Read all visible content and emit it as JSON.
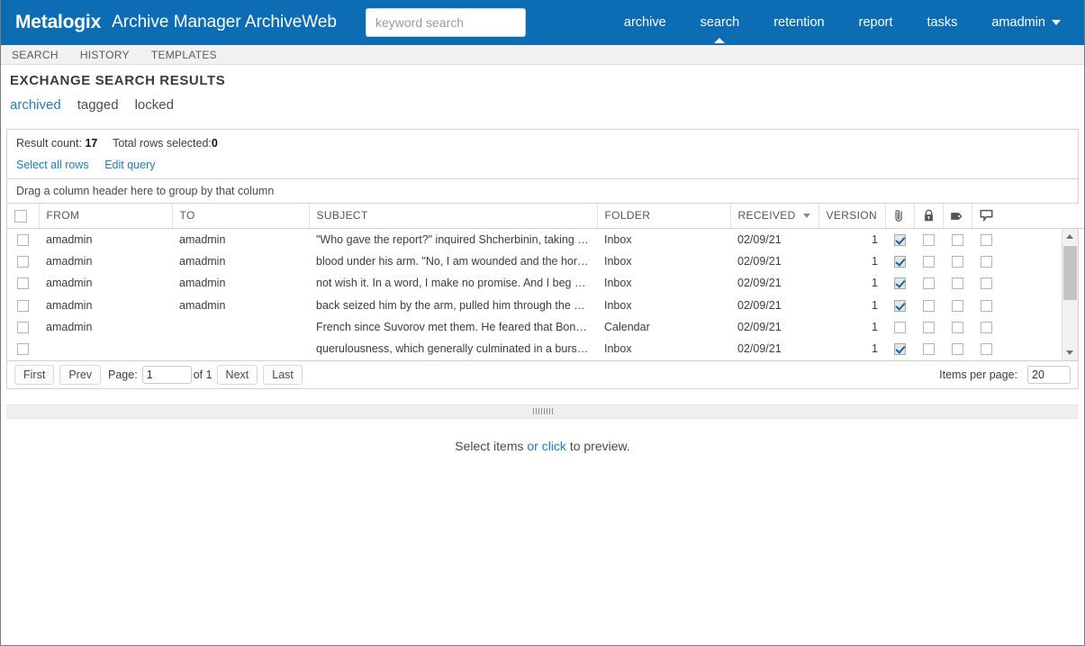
{
  "header": {
    "brand": "Metalogix",
    "app_name": "Archive Manager ArchiveWeb",
    "brand_color": "#0c6db5",
    "accent_color": "#1a7ec2",
    "search": {
      "placeholder": "keyword search",
      "value": "",
      "icon": "search-icon"
    },
    "nav": [
      {
        "label": "archive",
        "active": false
      },
      {
        "label": "search",
        "active": true
      },
      {
        "label": "retention",
        "active": false
      },
      {
        "label": "report",
        "active": false
      },
      {
        "label": "tasks",
        "active": false
      }
    ],
    "user_menu": {
      "label": "amadmin",
      "icon": "chevron-down-icon"
    }
  },
  "subtabs": [
    {
      "label": "SEARCH"
    },
    {
      "label": "HISTORY"
    },
    {
      "label": "TEMPLATES"
    }
  ],
  "page": {
    "title": "EXCHANGE SEARCH RESULTS",
    "filters": [
      {
        "label": "archived",
        "active": true
      },
      {
        "label": "tagged",
        "active": false
      },
      {
        "label": "locked",
        "active": false
      }
    ]
  },
  "results": {
    "result_count_label": "Result count:",
    "result_count_value": "17",
    "total_rows_label": "Total rows selected:",
    "total_rows_value": "0",
    "select_all_link": "Select all rows",
    "edit_query_link": "Edit query",
    "group_hint": "Drag a column header here to group by that column"
  },
  "grid": {
    "columns": [
      {
        "key": "select",
        "label": "",
        "type": "checkbox",
        "icon": "checkbox-icon"
      },
      {
        "key": "from",
        "label": "FROM",
        "type": "text"
      },
      {
        "key": "to",
        "label": "TO",
        "type": "text"
      },
      {
        "key": "subject",
        "label": "SUBJECT",
        "type": "text"
      },
      {
        "key": "folder",
        "label": "FOLDER",
        "type": "text"
      },
      {
        "key": "received",
        "label": "RECEIVED",
        "type": "text",
        "sorted": "desc",
        "icon": "sort-desc-icon"
      },
      {
        "key": "version",
        "label": "VERSION",
        "type": "number"
      },
      {
        "key": "attachment",
        "label": "",
        "type": "checkbox",
        "icon": "paperclip-icon"
      },
      {
        "key": "locked",
        "label": "",
        "type": "checkbox",
        "icon": "lock-icon"
      },
      {
        "key": "tagged",
        "label": "",
        "type": "checkbox",
        "icon": "tag-icon"
      },
      {
        "key": "comment",
        "label": "",
        "type": "checkbox",
        "icon": "speech-bubble-icon"
      },
      {
        "key": "spacer",
        "label": "",
        "type": "text"
      }
    ],
    "rows": [
      {
        "selected": false,
        "from": "amadmin",
        "to": "amadmin",
        "subject": "\"Who gave the report?\" inquired Shcherbinin, taking the ...",
        "folder": "Inbox",
        "received": "02/09/21",
        "version": "1",
        "attachment": true,
        "locked": false,
        "tagged": false,
        "comment": false
      },
      {
        "selected": false,
        "from": "amadmin",
        "to": "amadmin",
        "subject": "blood under his arm. \"No, I am wounded and the horse i...",
        "folder": "Inbox",
        "received": "02/09/21",
        "version": "1",
        "attachment": true,
        "locked": false,
        "tagged": false,
        "comment": false
      },
      {
        "selected": false,
        "from": "amadmin",
        "to": "amadmin",
        "subject": "not wish it. In a word, I make no promise. And I beg you ...",
        "folder": "Inbox",
        "received": "02/09/21",
        "version": "1",
        "attachment": true,
        "locked": false,
        "tagged": false,
        "comment": false
      },
      {
        "selected": false,
        "from": "amadmin",
        "to": "amadmin",
        "subject": "back seized him by the arm, pulled him through the wic...",
        "folder": "Inbox",
        "received": "02/09/21",
        "version": "1",
        "attachment": true,
        "locked": false,
        "tagged": false,
        "comment": false
      },
      {
        "selected": false,
        "from": "amadmin",
        "to": "",
        "subject": "French since Suvorov met them. He feared that Bonapart...",
        "folder": "Calendar",
        "received": "02/09/21",
        "version": "1",
        "attachment": false,
        "locked": false,
        "tagged": false,
        "comment": false
      },
      {
        "selected": false,
        "from": "",
        "to": "",
        "subject": "querulousness, which generally culminated in a burst of ...",
        "folder": "Inbox",
        "received": "02/09/21",
        "version": "1",
        "attachment": true,
        "locked": false,
        "tagged": false,
        "comment": false
      }
    ]
  },
  "pager": {
    "first": "First",
    "prev": "Prev",
    "page_label": "Page:",
    "page_value": "1",
    "of_label": "of 1",
    "next": "Next",
    "last": "Last",
    "items_per_page_label": "Items per page:",
    "items_per_page_value": "20"
  },
  "preview": {
    "text_before": "Select items",
    "link": "or click",
    "text_after": "to preview."
  }
}
